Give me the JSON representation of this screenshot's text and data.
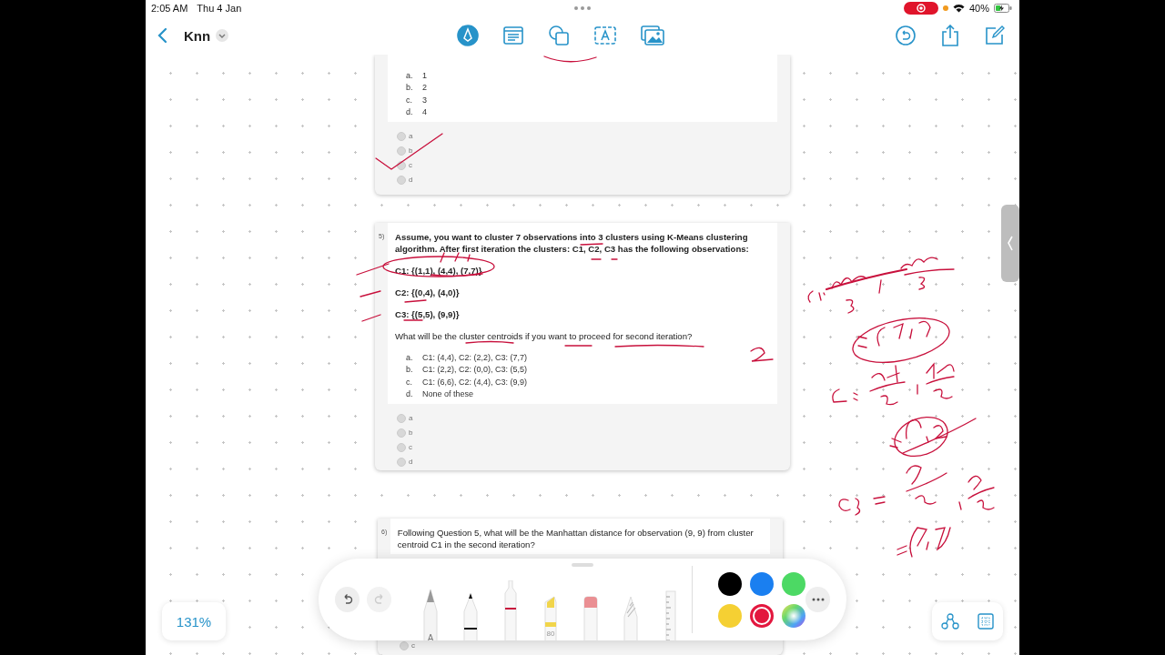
{
  "status_bar": {
    "time": "2:05 AM",
    "date": "Thu 4 Jan",
    "recording": true,
    "battery": "40%"
  },
  "nav": {
    "title": "Knn"
  },
  "insert_tools": [
    {
      "kind": "pen",
      "selected": true
    },
    {
      "kind": "note",
      "selected": false
    },
    {
      "kind": "shapes",
      "selected": false
    },
    {
      "kind": "textbox",
      "selected": false
    },
    {
      "kind": "media",
      "selected": false
    }
  ],
  "questions": [
    {
      "options": [
        {
          "letter": "a.",
          "text": "1"
        },
        {
          "letter": "b.",
          "text": "2"
        },
        {
          "letter": "c.",
          "text": "3"
        },
        {
          "letter": "d.",
          "text": "4"
        }
      ],
      "choices": [
        "a",
        "b",
        "c",
        "d"
      ]
    },
    {
      "number": "5)",
      "lines": [
        {
          "text": "Assume, you want to cluster 7 observations into 3 clusters using K-Means clustering algorithm. After first iteration the clusters: C1, C2, C3 has the following observations:",
          "bold": true
        },
        {
          "text": "C1: {(1,1), (4,4), (7,7)}",
          "bold": true
        },
        {
          "text": "C2: {(0,4), (4,0)}",
          "bold": true
        },
        {
          "text": "C3: {(5,5), (9,9)}",
          "bold": true
        },
        {
          "text": "What will be the cluster centroids if you want to proceed for second iteration?",
          "bold": false
        }
      ],
      "options": [
        {
          "letter": "a.",
          "text": "C1: (4,4), C2: (2,2), C3: (7,7)"
        },
        {
          "letter": "b.",
          "text": "C1: (2,2), C2: (0,0), C3: (5,5)"
        },
        {
          "letter": "c.",
          "text": "C1: (6,6), C2: (4,4), C3: (9,9)"
        },
        {
          "letter": "d.",
          "text": "None of these"
        }
      ],
      "choices": [
        "a",
        "b",
        "c",
        "d"
      ]
    },
    {
      "number": "6)",
      "lines": [
        {
          "text": "Following Question 5, what will be the Manhattan distance for observation (9, 9) from cluster centroid C1 in  the second iteration?",
          "bold": false
        }
      ],
      "choices": [
        "c"
      ]
    }
  ],
  "zoom": "131%",
  "drawing_tools": [
    {
      "kind": "pencil",
      "label": "A",
      "selected": false
    },
    {
      "kind": "pen",
      "selected": false
    },
    {
      "kind": "fineliner",
      "selected": true
    },
    {
      "kind": "highlighter",
      "label": "80",
      "selected": false
    },
    {
      "kind": "eraser",
      "selected": false
    },
    {
      "kind": "crayon",
      "selected": false
    },
    {
      "kind": "ruler",
      "selected": false
    }
  ],
  "colors": [
    {
      "kind": "swatch",
      "color": "#000000",
      "selected": false
    },
    {
      "kind": "swatch",
      "color": "#1a7ff0",
      "selected": false
    },
    {
      "kind": "swatch",
      "color": "#4cd964",
      "selected": false
    },
    {
      "kind": "swatch",
      "color": "#f5d033",
      "selected": false
    },
    {
      "kind": "swatch",
      "color": "#e3173e",
      "selected": true
    },
    {
      "kind": "wheel",
      "selected": false
    }
  ]
}
